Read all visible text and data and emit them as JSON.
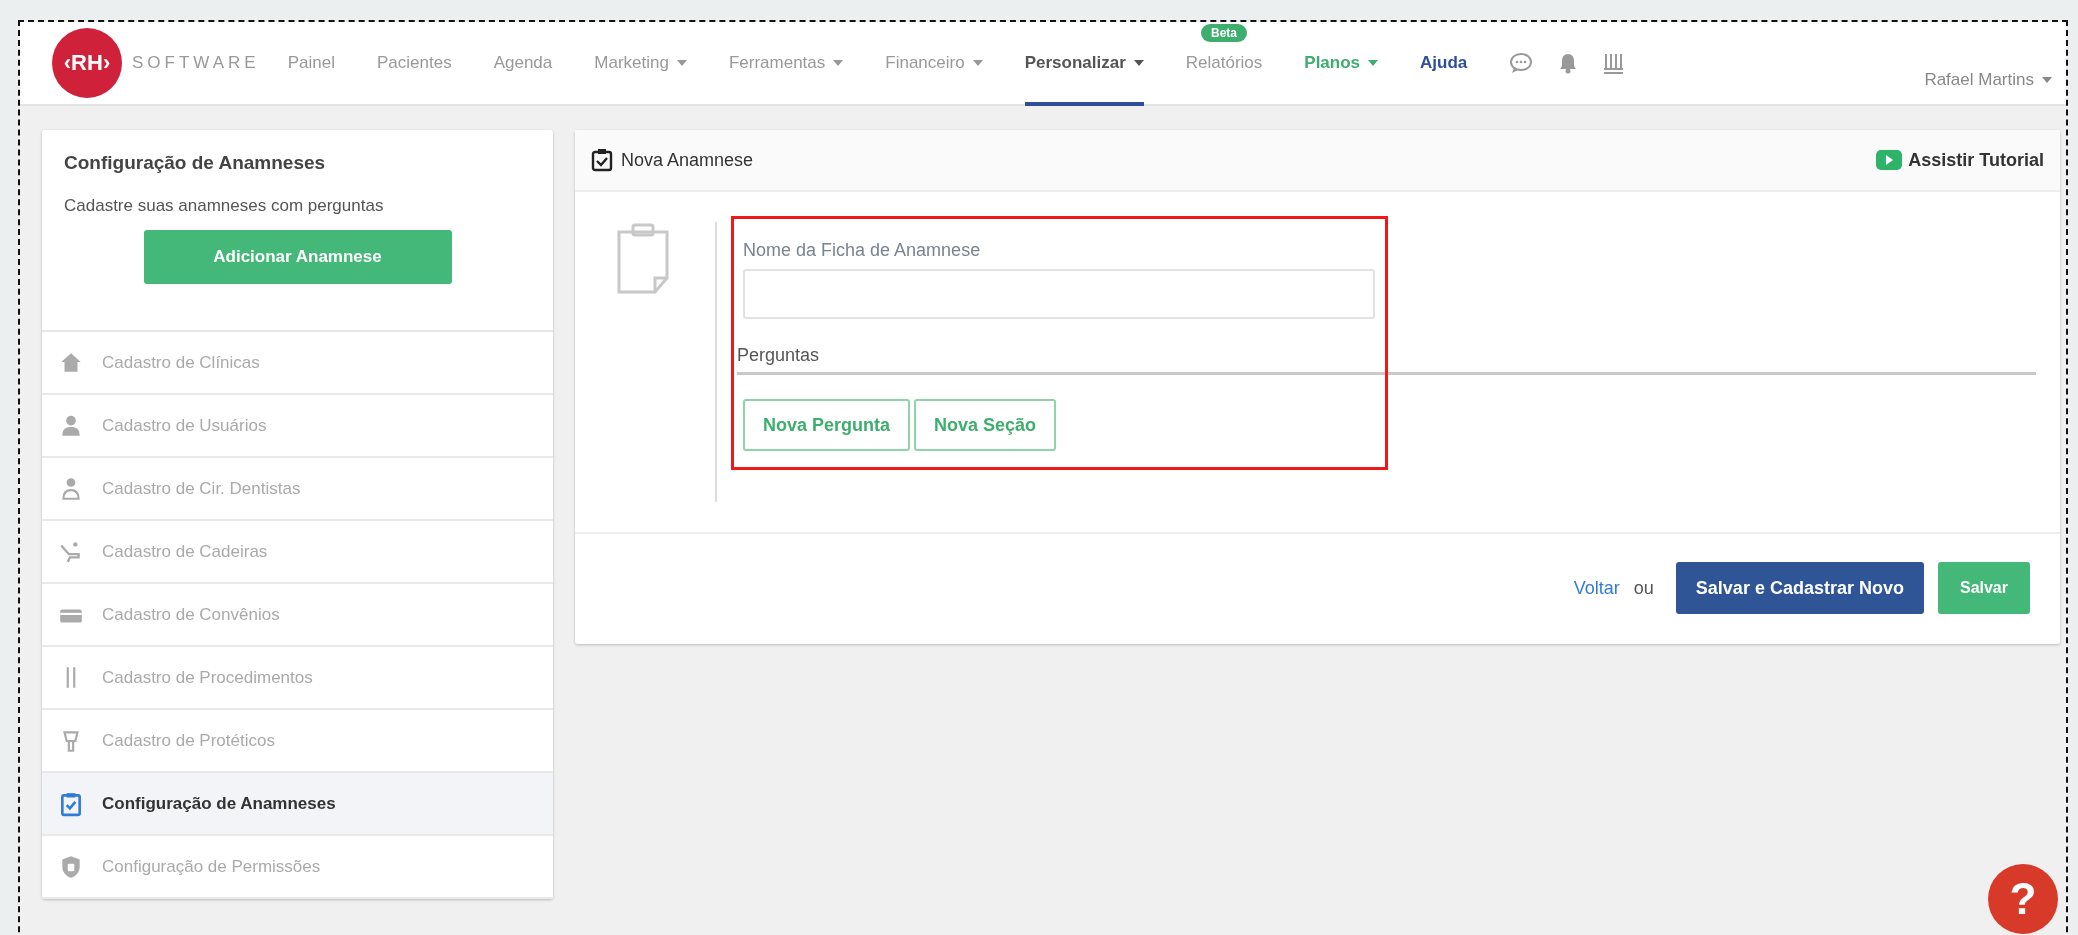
{
  "brand": {
    "logo": "‹RH›",
    "name": "SOFTWARE"
  },
  "nav": [
    {
      "label": "Painel",
      "dropdown": false,
      "selected": false
    },
    {
      "label": "Pacientes",
      "dropdown": false,
      "selected": false
    },
    {
      "label": "Agenda",
      "dropdown": false,
      "selected": false
    },
    {
      "label": "Marketing",
      "dropdown": true,
      "selected": false
    },
    {
      "label": "Ferramentas",
      "dropdown": true,
      "selected": false
    },
    {
      "label": "Financeiro",
      "dropdown": true,
      "selected": false
    },
    {
      "label": "Personalizar",
      "dropdown": true,
      "selected": true
    },
    {
      "label": "Relatórios",
      "dropdown": false,
      "selected": false,
      "badge": "Beta"
    },
    {
      "label": "Planos",
      "dropdown": true,
      "selected": false,
      "color": "#3dae6e"
    },
    {
      "label": "Ajuda",
      "dropdown": false,
      "selected": false,
      "color": "#2f4f9a"
    }
  ],
  "user": {
    "name": "Rafael Martins"
  },
  "sidebar": {
    "title": "Configuração de Anamneses",
    "subtitle": "Cadastre suas anamneses com perguntas",
    "button": "Adicionar Anamnese",
    "items": [
      {
        "label": "Cadastro de Clínicas",
        "selected": false
      },
      {
        "label": "Cadastro de Usuários",
        "selected": false
      },
      {
        "label": "Cadastro de Cir. Dentistas",
        "selected": false
      },
      {
        "label": "Cadastro de Cadeiras",
        "selected": false
      },
      {
        "label": "Cadastro de Convênios",
        "selected": false
      },
      {
        "label": "Cadastro de Procedimentos",
        "selected": false
      },
      {
        "label": "Cadastro de Protéticos",
        "selected": false
      },
      {
        "label": "Configuração de Anamneses",
        "selected": true
      },
      {
        "label": "Configuração de Permissões",
        "selected": false
      }
    ]
  },
  "panel": {
    "title": "Nova Anamnese",
    "tutorial": "Assistir Tutorial",
    "form": {
      "highlighted": true,
      "name_label": "Nome da Ficha de Anamnese",
      "questions_label": "Perguntas",
      "buttons": [
        "Nova Pergunta",
        "Nova Seção"
      ]
    },
    "footer": {
      "back": "Voltar",
      "or": "ou",
      "save_new": "Salvar e Cadastrar Novo",
      "save": "Salvar"
    }
  },
  "help_button": "?"
}
